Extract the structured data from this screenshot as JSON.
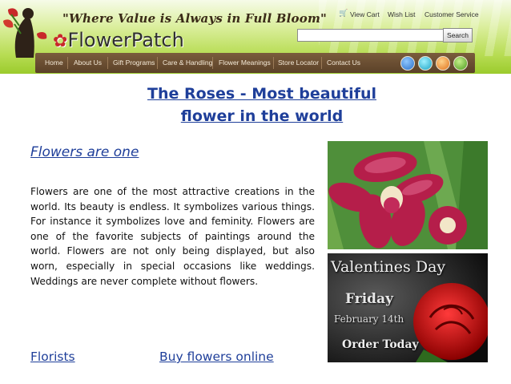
{
  "header": {
    "tagline": "\"Where Value is Always in Full Bloom\"",
    "logo": "FlowerPatch",
    "top_links": [
      "View Cart",
      "Wish List",
      "Customer Service"
    ],
    "search": {
      "placeholder": "",
      "button": "Search"
    },
    "nav": [
      "Home",
      "About Us",
      "Gift Programs",
      "Care & Handling",
      "Flower Meanings",
      "Store Locator",
      "Contact Us"
    ],
    "nav_icons": [
      "social-icon-blue",
      "social-icon-teal",
      "social-icon-orange",
      "social-icon-green"
    ]
  },
  "main": {
    "title_line1": "The Roses - Most beautiful",
    "title_line2": "flower in the world",
    "subheading": "Flowers are one",
    "paragraph": "Flowers are one of the most attractive creations in the world. Its beauty is endless. It symbolizes various things. For instance it symbolizes love and feminity. Flowers are one of the favorite subjects of paintings around the world. Flowers are not only being displayed, but also worn, especially in special occasions like weddings. Weddings are never complete without flowers.",
    "links": [
      "Florists",
      "Buy flowers online"
    ]
  },
  "images": {
    "orchid": {
      "icon": "orchid-photo"
    },
    "valentine": {
      "line1": "Valentines Day",
      "line2": "Friday",
      "line3": "February 14th",
      "line4": "Order Today"
    }
  },
  "colors": {
    "link_blue": "#1f3f9a",
    "nav_brown": "#6a4d31",
    "header_green": "#9bcb2d"
  }
}
